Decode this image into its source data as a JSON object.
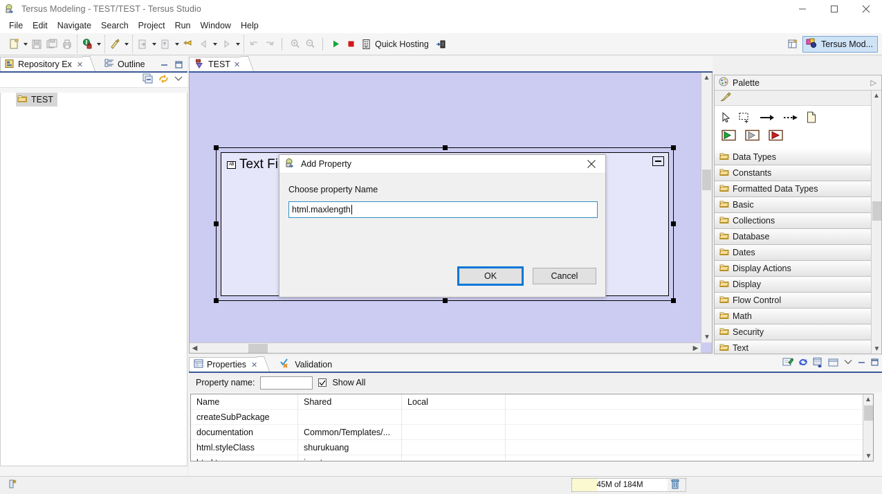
{
  "window": {
    "title": "Tersus Modeling - TEST/TEST - Tersus Studio",
    "icon": "tersus-app-icon",
    "minimize": "minimize-icon",
    "maximize": "maximize-icon",
    "close": "close-icon"
  },
  "menu": {
    "items": [
      "File",
      "Edit",
      "Navigate",
      "Search",
      "Project",
      "Run",
      "Window",
      "Help"
    ]
  },
  "toolbar": {
    "quick_hosting_label": "Quick Hosting",
    "groups": [
      {
        "name": "file-group",
        "buttons": [
          "new-icon",
          "save-icon",
          "save-all-icon",
          "print-icon"
        ],
        "arrows": [
          1
        ]
      },
      {
        "name": "debug-group",
        "buttons": [
          "debug-icon"
        ],
        "arrows": [
          1
        ]
      },
      {
        "name": "run-group",
        "buttons": [
          "run-icon"
        ],
        "arrows": [
          1
        ]
      },
      {
        "name": "nav-group",
        "buttons": [
          "export-icon",
          "import-icon",
          "last-edit-icon",
          "back-icon",
          "forward-icon"
        ],
        "arrows": [
          3
        ]
      },
      {
        "name": "undo-group",
        "buttons": [
          "undo-icon",
          "redo-icon"
        ],
        "arrows": []
      },
      {
        "name": "zoom-group",
        "buttons": [
          "zoom-in-icon",
          "zoom-out-icon"
        ],
        "arrows": []
      },
      {
        "name": "server-group",
        "buttons": [
          "start-server-icon",
          "stop-server-icon",
          "server-icon"
        ],
        "arrows": []
      }
    ]
  },
  "perspective": {
    "open_perspective": "open-perspective-icon",
    "active_label": "Tersus Mod...",
    "active_icon": "tersus-perspective-icon"
  },
  "repository_view": {
    "tabs": [
      {
        "label": "Repository Ex",
        "icon": "repository-icon",
        "active": true,
        "closeable": true
      },
      {
        "label": "Outline",
        "icon": "outline-icon",
        "active": false,
        "closeable": false
      }
    ],
    "view_buttons": [
      "minimize-view-icon",
      "maximize-view-icon"
    ],
    "toolbar": [
      "collapse-all-icon",
      "link-with-editor-icon",
      "view-menu-icon"
    ],
    "tree": [
      {
        "label": "TEST",
        "icon": "folder-icon",
        "selected": true
      }
    ]
  },
  "editor": {
    "tab": {
      "label": "TEST",
      "icon": "model-icon",
      "closeable": true
    },
    "canvas": {
      "background_color": "#ccccf2",
      "component": {
        "title": "Text Field",
        "title_icon": "ab-textfield-icon",
        "minimize_icon": "collapse-box-icon",
        "fill_color": "#e6e6fb",
        "port_color": "#c9e5a4"
      }
    },
    "scrollbars": {
      "h_left_arrow": "scroll-left-icon",
      "h_right_arrow": "scroll-right-icon",
      "v_up_arrow": "scroll-up-icon",
      "v_down_arrow": "scroll-down-icon"
    }
  },
  "palette": {
    "title": "Palette",
    "title_icon": "palette-icon",
    "collapse_icon": "palette-collapse-icon",
    "pin_icon": "pin-icon",
    "tools_row1": [
      "select-tool-icon",
      "marquee-tool-icon",
      "flow-arrow-icon",
      "dashed-arrow-icon",
      "note-icon"
    ],
    "tools_row2": [
      "start-green-icon",
      "step-gray-icon",
      "end-red-icon"
    ],
    "categories": [
      "Data Types",
      "Constants",
      "Formatted Data Types",
      "Basic",
      "Collections",
      "Database",
      "Dates",
      "Display Actions",
      "Display",
      "Flow Control",
      "Math",
      "Security",
      "Text"
    ],
    "category_icon": "folder-open-icon"
  },
  "properties_view": {
    "tabs": [
      {
        "label": "Properties",
        "icon": "properties-icon",
        "active": true,
        "closeable": true
      },
      {
        "label": "Validation",
        "icon": "validation-icon",
        "active": false,
        "closeable": false
      }
    ],
    "toolbar": [
      "pin-edit-icon",
      "refresh-icon",
      "add-row-icon",
      "restore-icon",
      "view-menu-icon",
      "minimize-view-icon",
      "maximize-view-icon"
    ],
    "filter": {
      "label": "Property name:",
      "input_value": "",
      "input_placeholder": "",
      "show_all_label": "Show All",
      "show_all_checked": true
    },
    "table": {
      "headers": [
        "Name",
        "Shared",
        "Local",
        ""
      ],
      "rows": [
        [
          "createSubPackage",
          "",
          "",
          ""
        ],
        [
          "documentation",
          "Common/Templates/...",
          "",
          ""
        ],
        [
          "html.styleClass",
          "shurukuang",
          "",
          ""
        ],
        [
          "html.tag",
          "input",
          "",
          ""
        ]
      ]
    }
  },
  "status_bar": {
    "left_icon": "writable-insert-icon",
    "heap_text": "45M of 184M",
    "trash_icon": "gc-trash-icon"
  },
  "dialog": {
    "title": "Add Property",
    "title_icon": "tersus-app-icon",
    "close_icon": "close-icon",
    "label": "Choose property Name",
    "input_value": "html.maxlength",
    "input_placeholder": "",
    "ok_label": "OK",
    "cancel_label": "Cancel",
    "accent_color": "#0078d7"
  }
}
